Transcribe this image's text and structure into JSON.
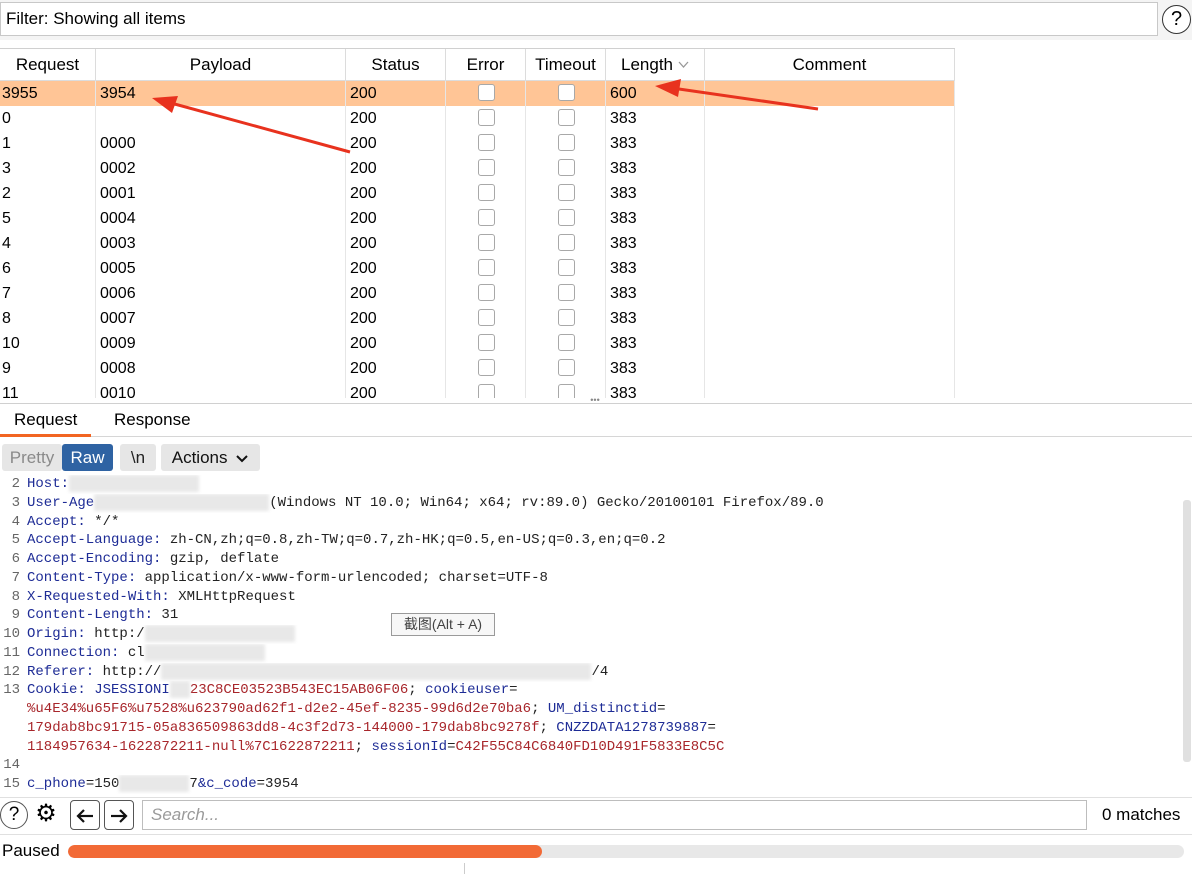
{
  "filter": {
    "text": "Filter: Showing all items",
    "help_icon": "help-icon"
  },
  "columns": [
    "Request",
    "Payload",
    "Status",
    "Error",
    "Timeout",
    "Length",
    "Comment"
  ],
  "sort_column": "Length",
  "rows": [
    {
      "request": "3955",
      "payload": "3954",
      "status": "200",
      "length": "600",
      "selected": true
    },
    {
      "request": "0",
      "payload": "",
      "status": "200",
      "length": "383"
    },
    {
      "request": "1",
      "payload": "0000",
      "status": "200",
      "length": "383"
    },
    {
      "request": "3",
      "payload": "0002",
      "status": "200",
      "length": "383"
    },
    {
      "request": "2",
      "payload": "0001",
      "status": "200",
      "length": "383"
    },
    {
      "request": "5",
      "payload": "0004",
      "status": "200",
      "length": "383"
    },
    {
      "request": "4",
      "payload": "0003",
      "status": "200",
      "length": "383"
    },
    {
      "request": "6",
      "payload": "0005",
      "status": "200",
      "length": "383"
    },
    {
      "request": "7",
      "payload": "0006",
      "status": "200",
      "length": "383"
    },
    {
      "request": "8",
      "payload": "0007",
      "status": "200",
      "length": "383"
    },
    {
      "request": "10",
      "payload": "0009",
      "status": "200",
      "length": "383"
    },
    {
      "request": "9",
      "payload": "0008",
      "status": "200",
      "length": "383"
    },
    {
      "request": "11",
      "payload": "0010",
      "status": "200",
      "length": "383"
    }
  ],
  "tabs": [
    "Request",
    "Response"
  ],
  "active_tab": "Request",
  "toolbar": {
    "pretty": "Pretty",
    "raw": "Raw",
    "newline": "\\n",
    "actions": "Actions",
    "actions_icon": "chevron-down-icon"
  },
  "editor": {
    "lines": [
      {
        "n": "2",
        "parts": [
          {
            "t": "Host:",
            "c": "k"
          },
          {
            "blur": 130
          }
        ]
      },
      {
        "n": "3",
        "parts": [
          {
            "t": "User-Age",
            "c": "k"
          },
          {
            "blur": 175
          },
          {
            "t": "(Windows NT 10.0; Win64; x64; rv:89.0) Gecko/20100101 Firefox/89.0",
            "c": "v"
          }
        ]
      },
      {
        "n": "4",
        "parts": [
          {
            "t": "Accept:",
            "c": "k"
          },
          {
            "t": " */*",
            "c": "v"
          }
        ]
      },
      {
        "n": "5",
        "parts": [
          {
            "t": "Accept-Language:",
            "c": "k"
          },
          {
            "t": " zh-CN,zh;q=0.8,zh-TW;q=0.7,zh-HK;q=0.5,en-US;q=0.3,en;q=0.2",
            "c": "v"
          }
        ]
      },
      {
        "n": "6",
        "parts": [
          {
            "t": "Accept-Encoding:",
            "c": "k"
          },
          {
            "t": " gzip, deflate",
            "c": "v"
          }
        ]
      },
      {
        "n": "7",
        "parts": [
          {
            "t": "Content-Type:",
            "c": "k"
          },
          {
            "t": " application/x-www-form-urlencoded; charset=UTF-8",
            "c": "v"
          }
        ]
      },
      {
        "n": "8",
        "parts": [
          {
            "t": "X-Requested-With:",
            "c": "k"
          },
          {
            "t": " XMLHttpRequest",
            "c": "v"
          }
        ]
      },
      {
        "n": "9",
        "parts": [
          {
            "t": "Content-Length:",
            "c": "k"
          },
          {
            "t": " 31",
            "c": "v"
          }
        ]
      },
      {
        "n": "10",
        "parts": [
          {
            "t": "Origin:",
            "c": "k"
          },
          {
            "t": " http:/",
            "c": "v"
          },
          {
            "blur": 150
          }
        ]
      },
      {
        "n": "11",
        "parts": [
          {
            "t": "Connection:",
            "c": "k"
          },
          {
            "t": " cl",
            "c": "v"
          },
          {
            "blur": 120
          }
        ]
      },
      {
        "n": "12",
        "parts": [
          {
            "t": "Referer:",
            "c": "k"
          },
          {
            "t": " http://",
            "c": "v"
          },
          {
            "blur": 430
          },
          {
            "t": "/4",
            "c": "v"
          }
        ]
      },
      {
        "n": "13",
        "parts": [
          {
            "t": "Cookie:",
            "c": "k"
          },
          {
            "t": " JSESSIONI",
            "c": "k"
          },
          {
            "blur": 20
          },
          {
            "t": "23C8CE03523B543EC15AB06F06",
            "c": "cv"
          },
          {
            "t": "; ",
            "c": "v"
          },
          {
            "t": "cookieuser",
            "c": "k"
          },
          {
            "t": "=",
            "c": "v"
          }
        ]
      },
      {
        "n": "",
        "parts": [
          {
            "t": "%u4E34%u65F6%u7528%u623790ad62f1-d2e2-45ef-8235-99d6d2e70ba6",
            "c": "cv"
          },
          {
            "t": "; ",
            "c": "v"
          },
          {
            "t": "UM_distinctid",
            "c": "k"
          },
          {
            "t": "=",
            "c": "v"
          }
        ]
      },
      {
        "n": "",
        "parts": [
          {
            "t": "179dab8bc91715-05a836509863dd8-4c3f2d73-144000-179dab8bc9278f",
            "c": "cv"
          },
          {
            "t": "; ",
            "c": "v"
          },
          {
            "t": "CNZZDATA1278739887",
            "c": "k"
          },
          {
            "t": "=",
            "c": "v"
          }
        ]
      },
      {
        "n": "",
        "parts": [
          {
            "t": "1184957634-1622872211-null%7C1622872211",
            "c": "cv"
          },
          {
            "t": "; ",
            "c": "v"
          },
          {
            "t": "sessionId",
            "c": "k"
          },
          {
            "t": "=",
            "c": "v"
          },
          {
            "t": "C42F55C84C6840FD10D491F5833E8C5C",
            "c": "cv"
          }
        ]
      },
      {
        "n": "14",
        "parts": []
      },
      {
        "n": "15",
        "parts": [
          {
            "t": "c_phone",
            "c": "k"
          },
          {
            "t": "=150",
            "c": "v"
          },
          {
            "blur": 70
          },
          {
            "t": "7",
            "c": "v"
          },
          {
            "t": "&c_code",
            "c": "k"
          },
          {
            "t": "=3954",
            "c": "v"
          }
        ]
      }
    ]
  },
  "screenshot_tip": "截图(Alt + A)",
  "search": {
    "placeholder": "Search...",
    "matches": "0 matches"
  },
  "status": {
    "text": "Paused",
    "progress": 0.425,
    "progress_color": "#f26a36"
  },
  "colors": {
    "selected_row": "#ffc596",
    "accent": "#f26522",
    "raw_button": "#2f63a3",
    "arrow": "#e8321e"
  }
}
